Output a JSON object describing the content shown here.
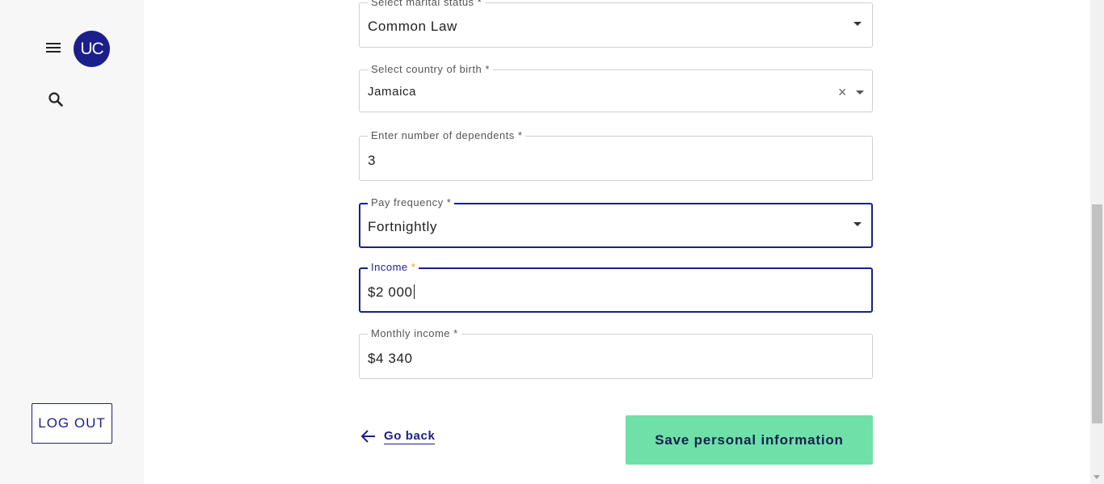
{
  "sidebar": {
    "avatar_initials": "UC",
    "logout_label": "LOG OUT",
    "menu_icon": "hamburger-menu-icon",
    "search_icon": "search-icon"
  },
  "form": {
    "marital_status": {
      "label": "Select marital status",
      "required": "*",
      "value": "Common Law"
    },
    "country_of_birth": {
      "label": "Select country of birth",
      "required": "*",
      "value": "Jamaica"
    },
    "dependents": {
      "label": "Enter number of dependents",
      "required": "*",
      "value": "3"
    },
    "pay_frequency": {
      "label": "Pay frequency",
      "required": "*",
      "value": "Fortnightly"
    },
    "income": {
      "label": "Income",
      "required": "*",
      "value": "$2 000"
    },
    "monthly_income": {
      "label": "Monthly income",
      "required": "*",
      "value": "$4 340"
    }
  },
  "actions": {
    "go_back_label": "Go back",
    "save_label": "Save personal information"
  },
  "colors": {
    "brand": "#1b1f8a",
    "save_button": "#6fe0a8",
    "required_star_active": "#f5a100"
  }
}
